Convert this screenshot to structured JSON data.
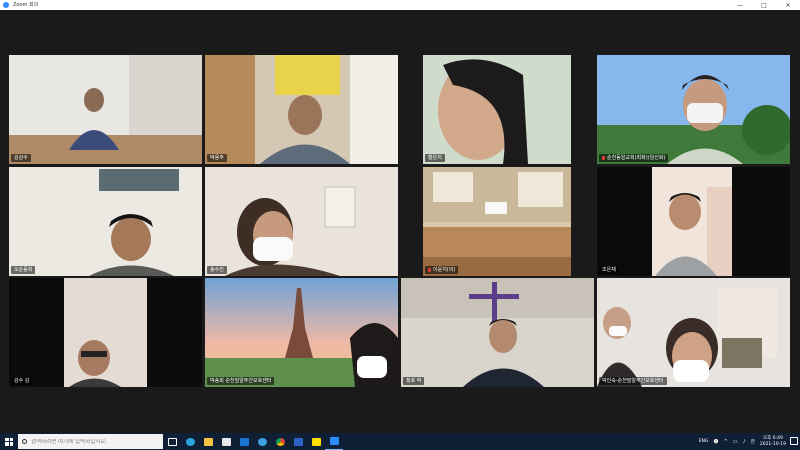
{
  "window": {
    "title": "Zoom 회의",
    "minimize": "—",
    "maximize": "□",
    "close": "✕"
  },
  "participants": [
    {
      "name": "김상수",
      "mic_muted": false
    },
    {
      "name": "박용주",
      "mic_muted": false
    },
    {
      "name": "황은지",
      "mic_muted": false
    },
    {
      "name": "순천동일교회(최화)(임선화)",
      "mic_muted": true
    },
    {
      "name": "오순동회",
      "mic_muted": false
    },
    {
      "name": "송수진",
      "mic_muted": false
    },
    {
      "name": "이윤지(의)",
      "mic_muted": true
    },
    {
      "name": "조은채",
      "mic_muted": false
    },
    {
      "name": "강수 김",
      "mic_muted": false
    },
    {
      "name": "박송희 순천밀알주간보호센터",
      "mic_muted": false,
      "active_speaker": true
    },
    {
      "name": "정호 박",
      "mic_muted": false
    },
    {
      "name": "박인숙-순천밀알주간보호센터",
      "mic_muted": false
    }
  ],
  "taskbar": {
    "search_placeholder": "검색하려면 여기에 입력하십시오.",
    "apps": [
      "task-view",
      "edge",
      "file-explorer",
      "store",
      "mail",
      "ie",
      "chrome",
      "word",
      "kakaotalk",
      "zoom"
    ],
    "tray_lang": "한",
    "time": "오후 6:49",
    "date": "2021-10-19",
    "tray_label": "ENG"
  },
  "colors": {
    "active_speaker_border": "#a4d65e",
    "taskbar_bg": "#0f1f36",
    "meeting_bg": "#1a1a1a"
  }
}
